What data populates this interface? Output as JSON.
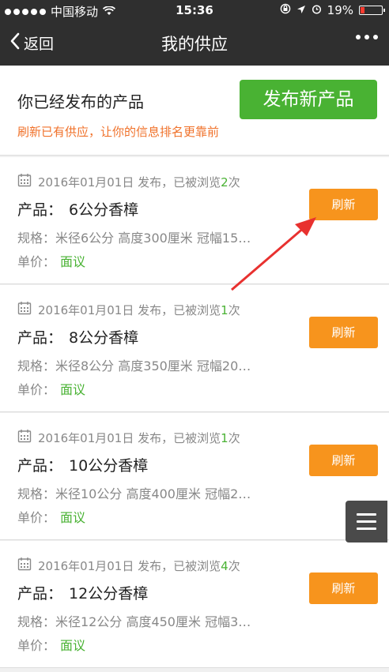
{
  "status_bar": {
    "carrier": "中国移动",
    "time": "15:36",
    "battery": "19%",
    "battery_level": 0.19
  },
  "nav": {
    "back_label": "返回",
    "title": "我的供应"
  },
  "header": {
    "heading": "你已经发布的产品",
    "publish_button": "发布新产品",
    "hint": "刷新已有供应，让你的信息排名更靠前"
  },
  "items": [
    {
      "date": "2016年01月01日",
      "meta_suffix": "发布，已被浏览",
      "views": "2",
      "views_unit": "次",
      "product_label": "产品：",
      "product": "6公分香樟",
      "spec": "规格：米径6公分 高度300厘米 冠幅15…",
      "price_label": "单价：",
      "price": "面议",
      "refresh_label": "刷新"
    },
    {
      "date": "2016年01月01日",
      "meta_suffix": "发布，已被浏览",
      "views": "1",
      "views_unit": "次",
      "product_label": "产品：",
      "product": "8公分香樟",
      "spec": "规格：米径8公分 高度350厘米 冠幅20…",
      "price_label": "单价：",
      "price": "面议",
      "refresh_label": "刷新"
    },
    {
      "date": "2016年01月01日",
      "meta_suffix": "发布，已被浏览",
      "views": "1",
      "views_unit": "次",
      "product_label": "产品：",
      "product": "10公分香樟",
      "spec": "规格：米径10公分 高度400厘米 冠幅2…",
      "price_label": "单价：",
      "price": "面议",
      "refresh_label": "刷新"
    },
    {
      "date": "2016年01月01日",
      "meta_suffix": "发布，已被浏览",
      "views": "4",
      "views_unit": "次",
      "product_label": "产品：",
      "product": "12公分香樟",
      "spec": "规格：米径12公分 高度450厘米 冠幅3…",
      "price_label": "单价：",
      "price": "面议",
      "refresh_label": "刷新"
    }
  ],
  "colors": {
    "accent_green": "#49b233",
    "refresh_orange": "#f7941d",
    "hint_orange": "#f0722b",
    "annotation_red": "#e8312f"
  },
  "icons": {
    "calendar": "calendar-icon",
    "menu": "hamburger-menu-icon"
  }
}
